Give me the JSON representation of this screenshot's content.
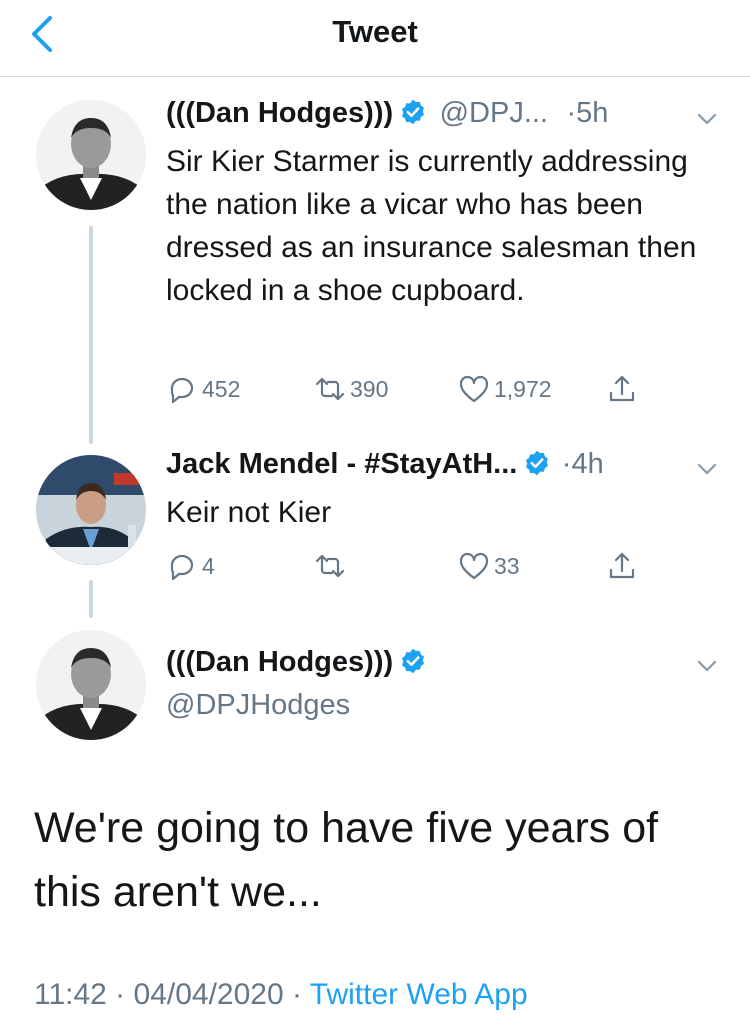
{
  "header": {
    "title": "Tweet"
  },
  "thread": [
    {
      "name": "(((Dan Hodges)))",
      "handle": "@DPJ...",
      "time": "·5h",
      "text": "Sir Kier Starmer is currently addressing the nation like a vicar who has been dressed as an insurance salesman then locked in a shoe cupboard.",
      "replies": "452",
      "retweets": "390",
      "likes": "1,972"
    },
    {
      "name": "Jack Mendel - #StayAtH...",
      "time": "·4h",
      "text": "Keir not Kier",
      "replies": "4",
      "retweets": "",
      "likes": "33"
    }
  ],
  "main_tweet": {
    "name": "(((Dan Hodges)))",
    "handle": "@DPJHodges",
    "text": "We're going to have five years of this aren't we...",
    "timestamp": "11:42 · 04/04/2020 · ",
    "source": "Twitter Web App"
  },
  "colors": {
    "accent": "#1da1f2",
    "secondary_text": "#657786",
    "border": "#d6dbe0"
  },
  "icons": [
    "chevron-left-icon",
    "verified-badge-icon",
    "chevron-down-icon",
    "reply-icon",
    "retweet-icon",
    "like-icon",
    "share-icon"
  ]
}
